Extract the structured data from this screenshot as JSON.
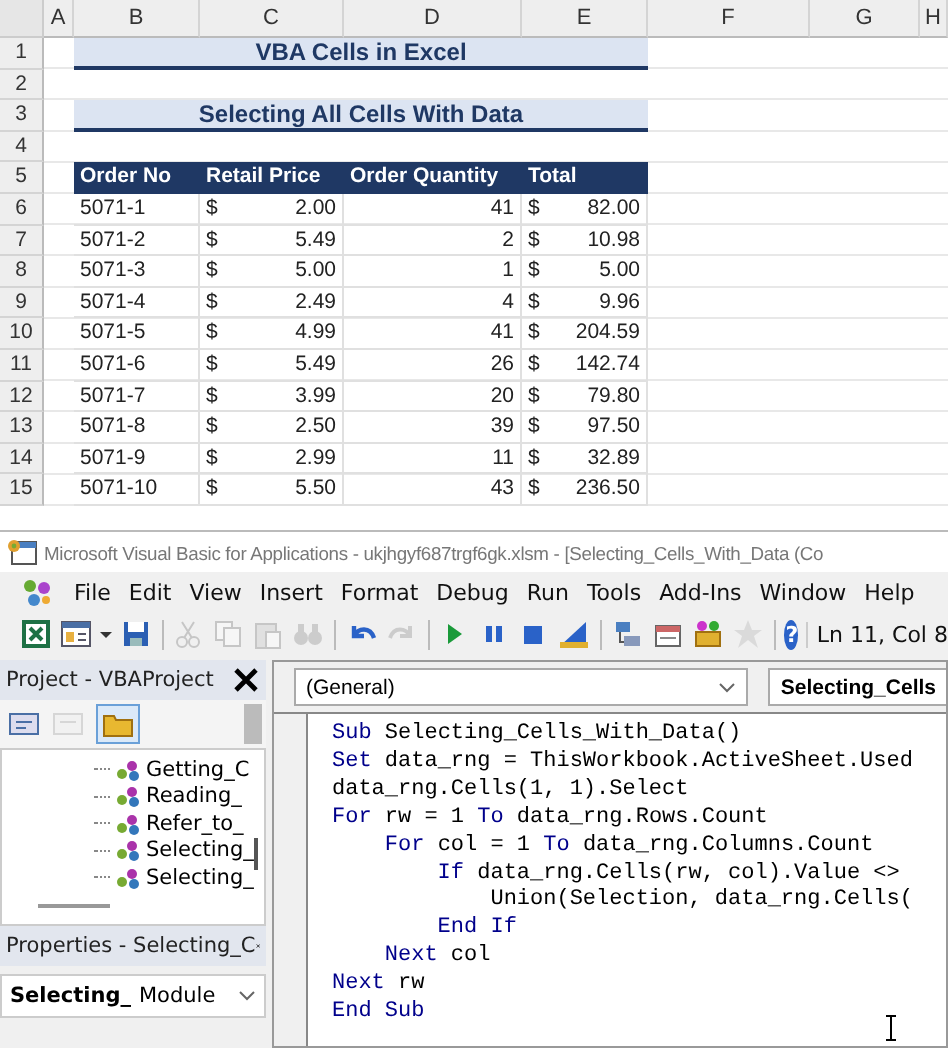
{
  "spreadsheet": {
    "columns": [
      "A",
      "B",
      "C",
      "D",
      "E",
      "F",
      "G",
      "H"
    ],
    "row_numbers": [
      "1",
      "2",
      "3",
      "4",
      "5",
      "6",
      "7",
      "8",
      "9",
      "10",
      "11",
      "12",
      "13",
      "14",
      "15"
    ],
    "title": "VBA Cells in Excel",
    "subtitle": "Selecting All Cells With Data",
    "headers": [
      "Order No",
      "Retail Price",
      "Order Quantity",
      "Total"
    ],
    "rows": [
      {
        "order_no": "5071-1",
        "price_symbol": "$",
        "price": "2.00",
        "quantity": "41",
        "total_symbol": "$",
        "total": "82.00"
      },
      {
        "order_no": "5071-2",
        "price_symbol": "$",
        "price": "5.49",
        "quantity": "2",
        "total_symbol": "$",
        "total": "10.98"
      },
      {
        "order_no": "5071-3",
        "price_symbol": "$",
        "price": "5.00",
        "quantity": "1",
        "total_symbol": "$",
        "total": "5.00"
      },
      {
        "order_no": "5071-4",
        "price_symbol": "$",
        "price": "2.49",
        "quantity": "4",
        "total_symbol": "$",
        "total": "9.96"
      },
      {
        "order_no": "5071-5",
        "price_symbol": "$",
        "price": "4.99",
        "quantity": "41",
        "total_symbol": "$",
        "total": "204.59"
      },
      {
        "order_no": "5071-6",
        "price_symbol": "$",
        "price": "5.49",
        "quantity": "26",
        "total_symbol": "$",
        "total": "142.74"
      },
      {
        "order_no": "5071-7",
        "price_symbol": "$",
        "price": "3.99",
        "quantity": "20",
        "total_symbol": "$",
        "total": "79.80"
      },
      {
        "order_no": "5071-8",
        "price_symbol": "$",
        "price": "2.50",
        "quantity": "39",
        "total_symbol": "$",
        "total": "97.50"
      },
      {
        "order_no": "5071-9",
        "price_symbol": "$",
        "price": "2.99",
        "quantity": "11",
        "total_symbol": "$",
        "total": "32.89"
      },
      {
        "order_no": "5071-10",
        "price_symbol": "$",
        "price": "5.50",
        "quantity": "43",
        "total_symbol": "$",
        "total": "236.50"
      }
    ]
  },
  "vba": {
    "title": "Microsoft Visual Basic for Applications - ukjhgyf687trgf6gk.xlsm - [Selecting_Cells_With_Data (Co",
    "menu": [
      "File",
      "Edit",
      "View",
      "Insert",
      "Format",
      "Debug",
      "Run",
      "Tools",
      "Add-Ins",
      "Window",
      "Help"
    ],
    "toolbar": [
      {
        "kind": "excel",
        "disabled": false
      },
      {
        "kind": "form",
        "disabled": false
      },
      {
        "kind": "dropdown",
        "disabled": false
      },
      {
        "kind": "save",
        "disabled": false
      },
      {
        "kind": "separator"
      },
      {
        "kind": "cut",
        "disabled": true
      },
      {
        "kind": "copy",
        "disabled": true
      },
      {
        "kind": "paste",
        "disabled": true
      },
      {
        "kind": "find",
        "disabled": true
      },
      {
        "kind": "separator"
      },
      {
        "kind": "undo",
        "disabled": false
      },
      {
        "kind": "redo",
        "disabled": true
      },
      {
        "kind": "separator"
      },
      {
        "kind": "run",
        "disabled": false
      },
      {
        "kind": "pause",
        "disabled": false
      },
      {
        "kind": "stop",
        "disabled": false
      },
      {
        "kind": "design",
        "disabled": false
      },
      {
        "kind": "separator"
      },
      {
        "kind": "project",
        "disabled": false
      },
      {
        "kind": "properties",
        "disabled": false
      },
      {
        "kind": "toolbox",
        "disabled": false
      },
      {
        "kind": "browser",
        "disabled": true
      },
      {
        "kind": "separator"
      },
      {
        "kind": "help",
        "disabled": false,
        "glyph": "?"
      }
    ],
    "position": "Ln 11, Col 8",
    "project": {
      "title": "Project - VBAProject",
      "tree": [
        "Getting_C",
        "Reading_",
        "Refer_to_",
        "Selecting_",
        "Selecting_"
      ]
    },
    "properties": {
      "title": "Properties - Selecting_C",
      "object": "Selecting_",
      "type": "Module"
    },
    "code": {
      "object": "(General)",
      "procedure": "Selecting_Cells",
      "lines": [
        [
          {
            "text": "Sub",
            "kind": "keyword"
          },
          {
            "text": " Selecting_Cells_With_Data()",
            "kind": "plain"
          }
        ],
        [
          {
            "text": "Set",
            "kind": "keyword"
          },
          {
            "text": " data_rng = ThisWorkbook.ActiveSheet.Used",
            "kind": "plain"
          }
        ],
        [
          {
            "text": "data_rng.Cells(1, 1).Select",
            "kind": "plain"
          }
        ],
        [
          {
            "text": "For",
            "kind": "keyword"
          },
          {
            "text": " rw = 1 ",
            "kind": "plain"
          },
          {
            "text": "To",
            "kind": "keyword"
          },
          {
            "text": " data_rng.Rows.Count",
            "kind": "plain"
          }
        ],
        [
          {
            "text": "    For",
            "kind": "keyword"
          },
          {
            "text": " col = 1 ",
            "kind": "plain"
          },
          {
            "text": "To",
            "kind": "keyword"
          },
          {
            "text": " data_rng.Columns.Count",
            "kind": "plain"
          }
        ],
        [
          {
            "text": "        If",
            "kind": "keyword"
          },
          {
            "text": " data_rng.Cells(rw, col).Value <>",
            "kind": "plain"
          }
        ],
        [
          {
            "text": "            Union(Selection, data_rng.Cells(",
            "kind": "plain"
          }
        ],
        [
          {
            "text": "        End If",
            "kind": "keyword"
          }
        ],
        [
          {
            "text": "    Next",
            "kind": "keyword"
          },
          {
            "text": " col",
            "kind": "plain"
          }
        ],
        [
          {
            "text": "Next",
            "kind": "keyword"
          },
          {
            "text": " rw",
            "kind": "plain"
          }
        ],
        [
          {
            "text": "End Sub",
            "kind": "keyword"
          }
        ]
      ]
    }
  }
}
